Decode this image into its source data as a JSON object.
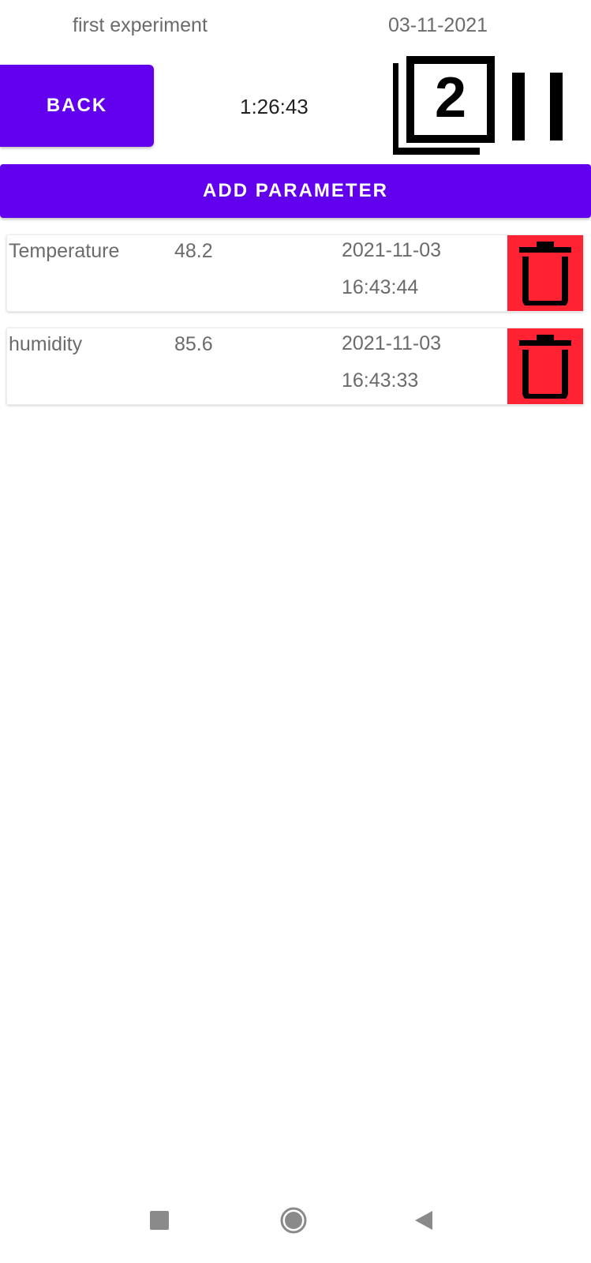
{
  "header": {
    "title": "first experiment",
    "date": "03-11-2021"
  },
  "controls": {
    "back_label": "BACK",
    "timer": "1:26:43",
    "copy_icon": "copy-2-icon",
    "pause_icon": "pause-icon"
  },
  "add_parameter_label": "ADD PARAMETER",
  "parameters": [
    {
      "name": "Temperature",
      "value": "48.2",
      "date": "2021-11-03",
      "time": "16:43:44"
    },
    {
      "name": "humidity",
      "value": "85.6",
      "date": "2021-11-03",
      "time": "16:43:33"
    }
  ],
  "colors": {
    "accent": "#6200ee",
    "delete": "#ff2233"
  },
  "navigation": {
    "icons": [
      "recents-icon",
      "home-icon",
      "back-icon"
    ]
  }
}
